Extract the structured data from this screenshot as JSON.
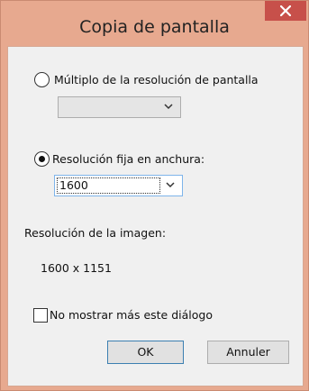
{
  "window": {
    "title": "Copia de pantalla",
    "close_symbol": "✕"
  },
  "options": {
    "multiple_label": "Múltiplo de la resolución de pantalla",
    "multiple_selected": false,
    "multiple_value": "",
    "fixed_label": "Resolución fija en anchura:",
    "fixed_selected": true,
    "fixed_value": "1600"
  },
  "image": {
    "resolution_label": "Resolución de la imagen:",
    "resolution_value": "1600 x 1151"
  },
  "footer": {
    "dont_show_label": "No mostrar más este diálogo",
    "dont_show_checked": false,
    "ok_label": "OK",
    "cancel_label": "Annuler"
  },
  "icons": {
    "close": "close-icon",
    "dropdown": "chevron-down-icon"
  },
  "colors": {
    "title_bar": "#e7a98f",
    "close_button": "#c7504a",
    "client_background": "#f0f0f0",
    "default_button_border": "#3c7fb1"
  }
}
